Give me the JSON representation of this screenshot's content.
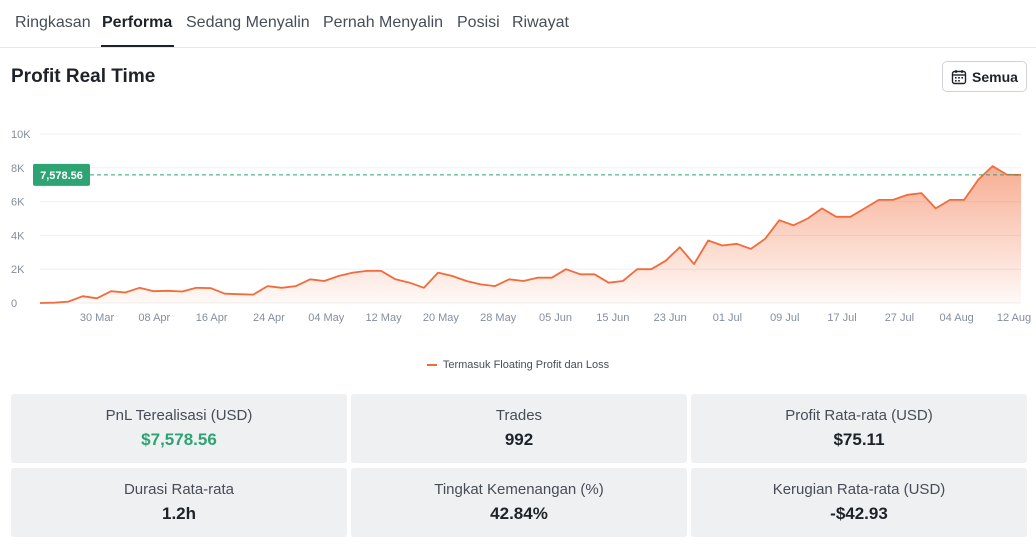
{
  "tabs": [
    {
      "label": "Ringkasan",
      "active": false
    },
    {
      "label": "Performa",
      "active": true
    },
    {
      "label": "Sedang Menyalin",
      "active": false
    },
    {
      "label": "Pernah Menyalin",
      "active": false
    },
    {
      "label": "Posisi",
      "active": false
    },
    {
      "label": "Riwayat",
      "active": false
    }
  ],
  "section": {
    "title": "Profit Real Time",
    "range_button": "Semua",
    "range_icon": "calendar-icon"
  },
  "chart_data": {
    "type": "area",
    "y_ticks": [
      "10K",
      "8K",
      "6K",
      "4K",
      "2K",
      "0"
    ],
    "ylim": [
      0,
      10000
    ],
    "x_ticks": [
      "30 Mar",
      "08 Apr",
      "16 Apr",
      "24 Apr",
      "04 May",
      "12 May",
      "20 May",
      "28 May",
      "05 Jun",
      "15 Jun",
      "23 Jun",
      "01 Jul",
      "09 Jul",
      "17 Jul",
      "27 Jul",
      "04 Aug",
      "12 Aug"
    ],
    "current_value_label": "7,578.56",
    "current_value": 7578.56,
    "series": [
      {
        "name": "Termasuk Floating Profit dan Loss",
        "color": "#f26b3a",
        "values": [
          0,
          20,
          80,
          400,
          280,
          700,
          620,
          900,
          700,
          720,
          680,
          900,
          880,
          550,
          520,
          500,
          1000,
          900,
          1000,
          1400,
          1300,
          1600,
          1800,
          1900,
          1900,
          1400,
          1200,
          900,
          1800,
          1600,
          1300,
          1100,
          1000,
          1400,
          1300,
          1500,
          1500,
          2000,
          1700,
          1700,
          1200,
          1300,
          2000,
          2000,
          2500,
          3300,
          2300,
          3700,
          3400,
          3500,
          3200,
          3800,
          4900,
          4600,
          5000,
          5600,
          5100,
          5100,
          5600,
          6100,
          6100,
          6400,
          6500,
          5600,
          6100,
          6100,
          7300,
          8100,
          7600,
          7578.56
        ]
      }
    ],
    "grid": true,
    "reference_line_color": "#2ea374",
    "legend_position": "bottom"
  },
  "stats": [
    {
      "label": "PnL Terealisasi (USD)",
      "value": "$7,578.56",
      "positive": true
    },
    {
      "label": "Trades",
      "value": "992",
      "positive": false
    },
    {
      "label": "Profit Rata-rata (USD)",
      "value": "$75.11",
      "positive": false
    },
    {
      "label": "Durasi Rata-rata",
      "value": "1.2h",
      "positive": false
    },
    {
      "label": "Tingkat Kemenangan (%)",
      "value": "42.84%",
      "positive": false
    },
    {
      "label": "Kerugian Rata-rata (USD)",
      "value": "-$42.93",
      "positive": false
    }
  ]
}
